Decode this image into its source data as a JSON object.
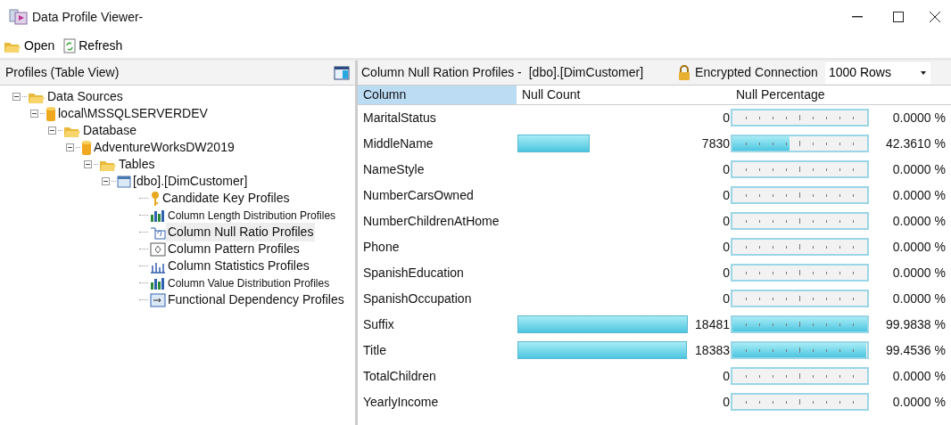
{
  "window": {
    "title": "Data Profile Viewer-"
  },
  "toolbar": [
    {
      "label": "Open",
      "kind": "open"
    },
    {
      "label": "Refresh",
      "kind": "refresh"
    }
  ],
  "left_panel": {
    "title": "Profiles (Table View)",
    "tree": [
      {
        "label": "Data Sources",
        "kind": "folder",
        "expanded": true,
        "selected": false,
        "children": [
          {
            "label": "local\\MSSQLSERVERDEV",
            "kind": "database",
            "expanded": true,
            "selected": false,
            "children": [
              {
                "label": "Database",
                "kind": "folder",
                "expanded": true,
                "selected": false,
                "children": [
                  {
                    "label": "AdventureWorksDW2019",
                    "kind": "database",
                    "expanded": true,
                    "selected": false,
                    "children": [
                      {
                        "label": "Tables",
                        "kind": "folder",
                        "expanded": true,
                        "selected": false,
                        "children": [
                          {
                            "label": "[dbo].[DimCustomer]",
                            "kind": "table",
                            "expanded": true,
                            "selected": false,
                            "children": [
                              {
                                "label": "Candidate Key Profiles",
                                "kind": "key",
                                "selected": false
                              },
                              {
                                "label": "Column Length Distribution Profiles",
                                "kind": "chart",
                                "small": true,
                                "selected": false
                              },
                              {
                                "label": "Column Null Ratio Profiles",
                                "kind": "null",
                                "selected": true
                              },
                              {
                                "label": "Column Pattern Profiles",
                                "kind": "pattern",
                                "selected": false
                              },
                              {
                                "label": "Column Statistics Profiles",
                                "kind": "stats",
                                "selected": false
                              },
                              {
                                "label": "Column Value Distribution Profiles",
                                "kind": "chart",
                                "small": true,
                                "selected": false
                              },
                              {
                                "label": "Functional Dependency Profiles",
                                "kind": "dependency",
                                "selected": false
                              }
                            ]
                          }
                        ]
                      }
                    ]
                  }
                ]
              }
            ]
          }
        ]
      }
    ]
  },
  "right_panel": {
    "title": "Column Null Ration Profiles -",
    "table_name": "[dbo].[DimCustomer]",
    "connection": "Encrypted Connection",
    "rows_option": "1000 Rows",
    "table": {
      "columns": [
        {
          "label": "Column",
          "selected": true
        },
        {
          "label": "Null Count",
          "selected": false
        },
        {
          "label": "Null Percentage",
          "selected": false
        }
      ],
      "rows": [
        {
          "column": "MaritalStatus",
          "null_count": "0",
          "percentage": "0.0000 %",
          "level": 0
        },
        {
          "column": "MiddleName",
          "null_count": "7830",
          "percentage": "42.3610 %",
          "level": 0.4236
        },
        {
          "column": "NameStyle",
          "null_count": "0",
          "percentage": "0.0000 %",
          "level": 0
        },
        {
          "column": "NumberCarsOwned",
          "null_count": "0",
          "percentage": "0.0000 %",
          "level": 0
        },
        {
          "column": "NumberChildrenAtHome",
          "null_count": "0",
          "percentage": "0.0000 %",
          "level": 0
        },
        {
          "column": "Phone",
          "null_count": "0",
          "percentage": "0.0000 %",
          "level": 0
        },
        {
          "column": "SpanishEducation",
          "null_count": "0",
          "percentage": "0.0000 %",
          "level": 0
        },
        {
          "column": "SpanishOccupation",
          "null_count": "0",
          "percentage": "0.0000 %",
          "level": 0
        },
        {
          "column": "Suffix",
          "null_count": "18481",
          "percentage": "99.9838 %",
          "level": 0.9998
        },
        {
          "column": "Title",
          "null_count": "18383",
          "percentage": "99.4536 %",
          "level": 0.9945
        },
        {
          "column": "TotalChildren",
          "null_count": "0",
          "percentage": "0.0000 %",
          "level": 0
        },
        {
          "column": "YearlyIncome",
          "null_count": "0",
          "percentage": "0.0000 %",
          "level": 0
        }
      ]
    }
  }
}
